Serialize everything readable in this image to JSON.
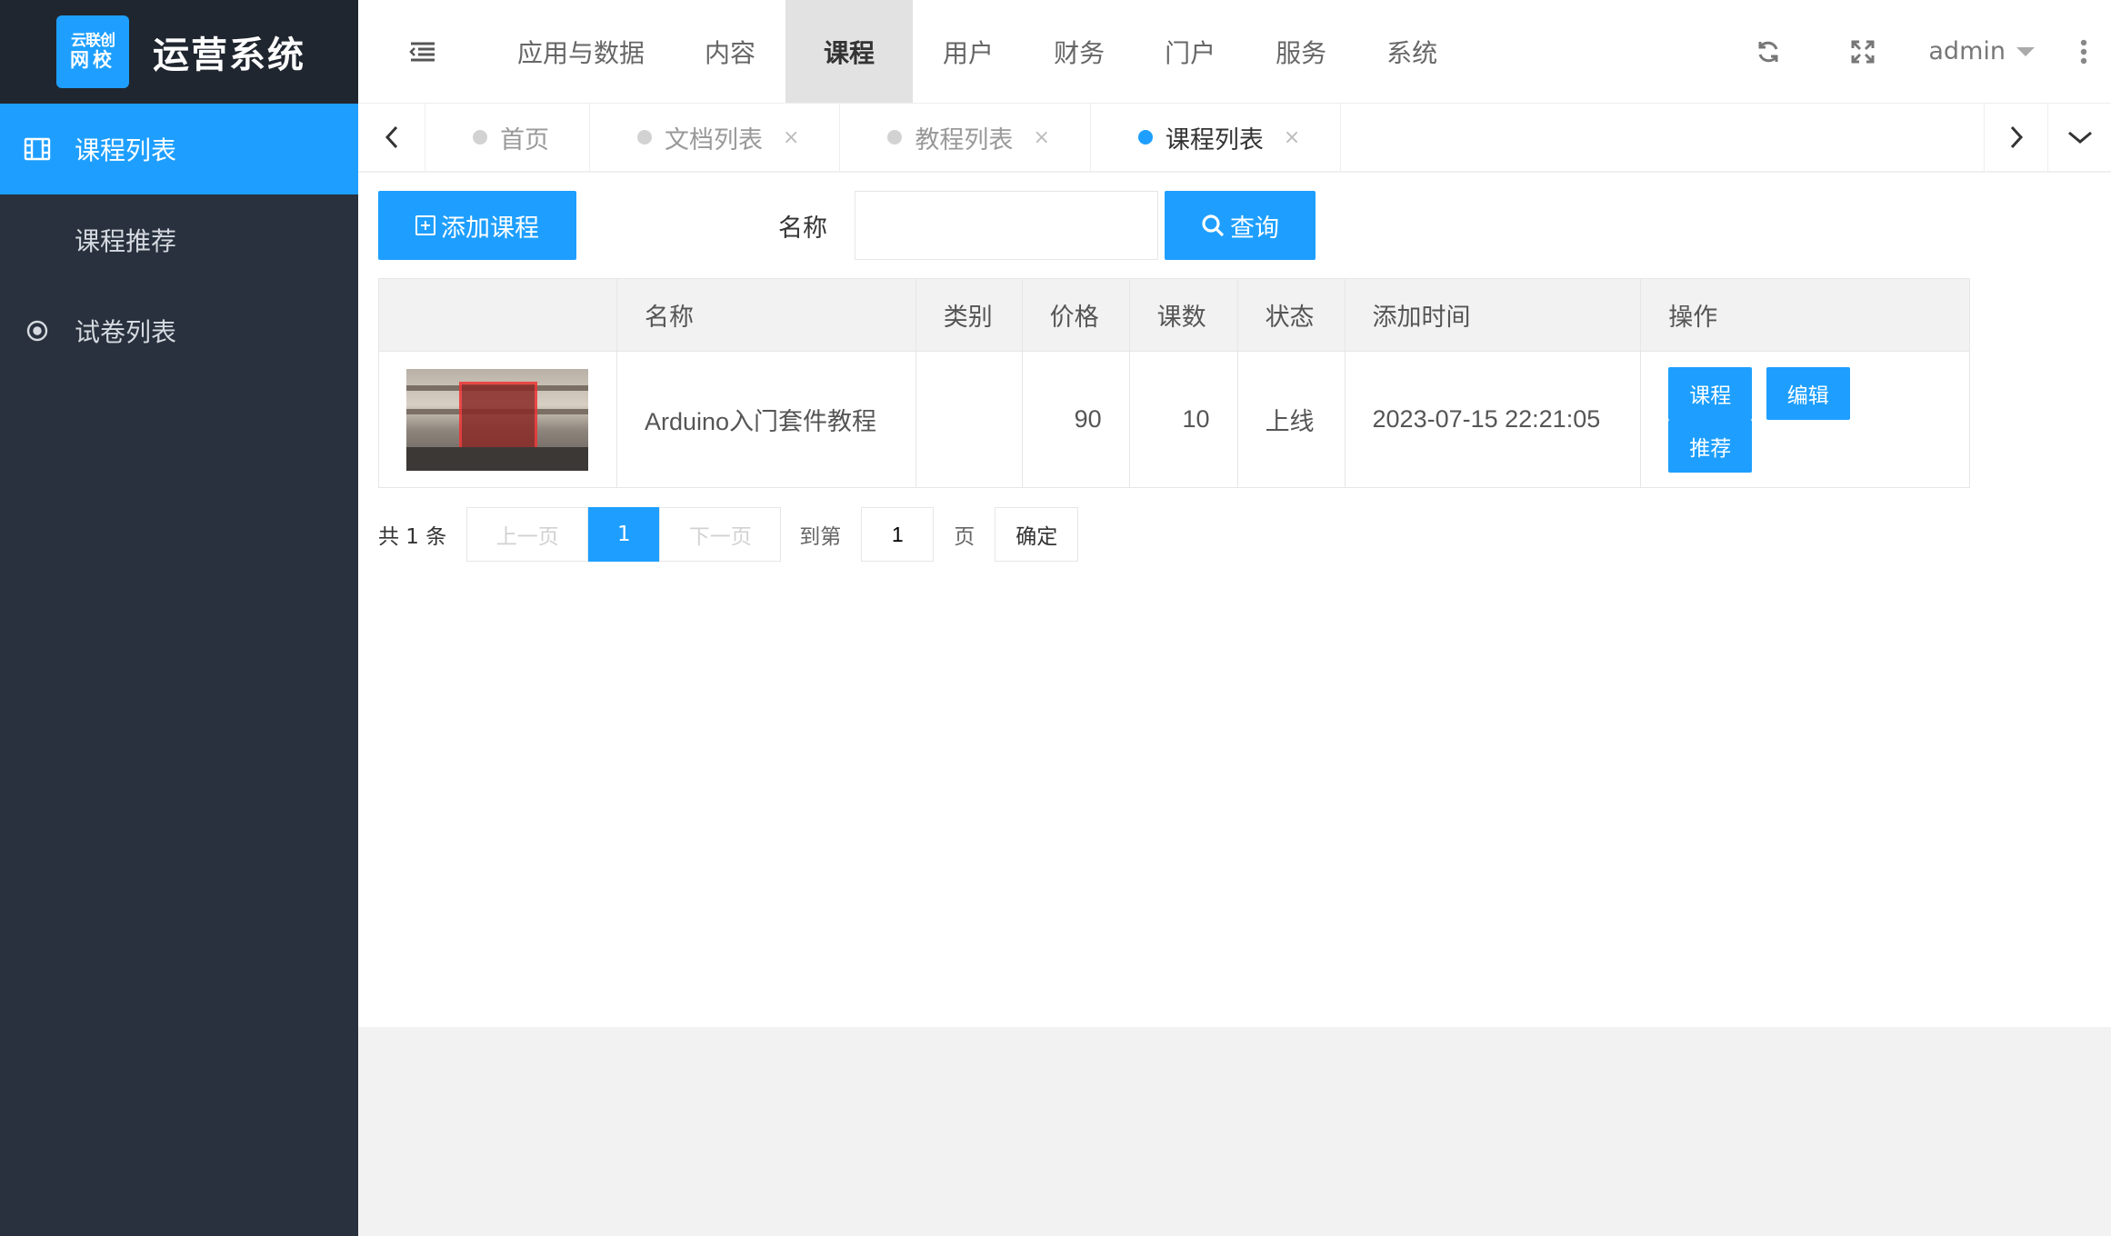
{
  "app": {
    "logo_line1": "云联创",
    "logo_line2": "网校",
    "title": "运营系统"
  },
  "sidebar": {
    "items": [
      {
        "label": "课程列表",
        "icon": "film-icon",
        "active": true
      },
      {
        "label": "课程推荐",
        "icon": "",
        "active": false
      },
      {
        "label": "试卷列表",
        "icon": "target-icon",
        "active": false
      }
    ]
  },
  "topbar": {
    "menu": [
      {
        "label": "应用与数据"
      },
      {
        "label": "内容"
      },
      {
        "label": "课程",
        "active": true
      },
      {
        "label": "用户"
      },
      {
        "label": "财务"
      },
      {
        "label": "门户"
      },
      {
        "label": "服务"
      },
      {
        "label": "系统"
      }
    ],
    "user": "admin"
  },
  "tabs": [
    {
      "label": "首页",
      "closable": false
    },
    {
      "label": "文档列表",
      "closable": true
    },
    {
      "label": "教程列表",
      "closable": true
    },
    {
      "label": "课程列表",
      "closable": true,
      "active": true
    }
  ],
  "tab_close_glyph": "×",
  "toolbar": {
    "add_label": "添加课程",
    "search_label": "名称",
    "search_value": "",
    "query_label": "查询"
  },
  "table": {
    "columns": [
      "",
      "名称",
      "类别",
      "价格",
      "课数",
      "状态",
      "添加时间",
      "操作"
    ],
    "rows": [
      {
        "name": "Arduino入门套件教程",
        "category": "",
        "price": "90",
        "lessons": "10",
        "status": "上线",
        "added": "2023-07-15 22:21:05",
        "actions": [
          "课程",
          "编辑",
          "推荐"
        ]
      }
    ]
  },
  "pager": {
    "total": "共 1 条",
    "prev": "上一页",
    "current": "1",
    "next": "下一页",
    "goto_label": "到第",
    "goto_value": "1",
    "unit": "页",
    "confirm": "确定"
  },
  "colors": {
    "accent": "#1e9fff",
    "sidebar_bg": "#28313d",
    "logo_bar_bg": "#20262f"
  }
}
